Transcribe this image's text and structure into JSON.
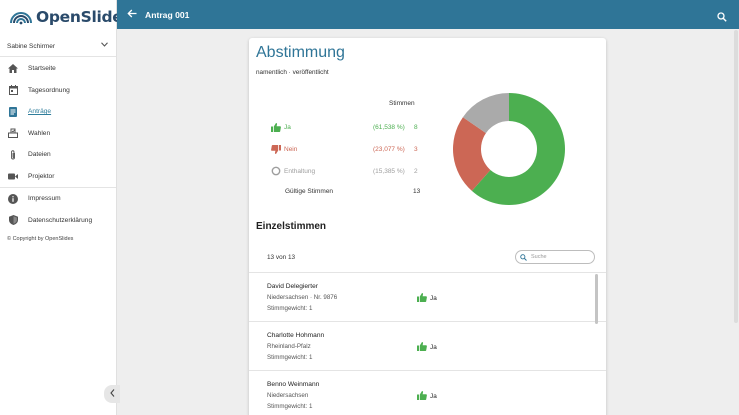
{
  "app": {
    "name": "OpenSlides"
  },
  "user": {
    "name": "Sabine Schirmer"
  },
  "nav": {
    "items": [
      {
        "label": "Startseite",
        "icon": "home-icon"
      },
      {
        "label": "Tagesordnung",
        "icon": "calendar-icon"
      },
      {
        "label": "Anträge",
        "icon": "document-icon",
        "active": true
      },
      {
        "label": "Wahlen",
        "icon": "ballot-icon"
      },
      {
        "label": "Dateien",
        "icon": "paperclip-icon"
      },
      {
        "label": "Projektor",
        "icon": "videocam-icon"
      }
    ],
    "secondary": [
      {
        "label": "Impressum",
        "icon": "info-icon"
      },
      {
        "label": "Datenschutzerklärung",
        "icon": "shield-icon"
      }
    ]
  },
  "copyright": "© Copyright by OpenSlides",
  "header": {
    "title": "Antrag 001"
  },
  "poll": {
    "title": "Abstimmung",
    "subtitle": "namentlich · veröffentlicht",
    "column_header": "Stimmen",
    "results": [
      {
        "label": "Ja",
        "percent": "(61,538 %)",
        "votes": "8",
        "color": "#4caf50",
        "icon": "thumb-up-icon"
      },
      {
        "label": "Nein",
        "percent": "(23,077 %)",
        "votes": "3",
        "color": "#cc6755",
        "icon": "thumb-down-icon"
      },
      {
        "label": "Enthaltung",
        "percent": "(15,385 %)",
        "votes": "2",
        "color": "#9e9e9e",
        "icon": "circle-icon"
      }
    ],
    "valid_label": "Gültige Stimmen",
    "valid_votes": "13"
  },
  "chart_data": {
    "type": "pie",
    "categories": [
      "Ja",
      "Nein",
      "Enthaltung"
    ],
    "values": [
      8,
      3,
      2
    ],
    "colors": [
      "#4caf50",
      "#cc6755",
      "#aaaaaa"
    ]
  },
  "single_votes": {
    "title": "Einzelstimmen",
    "count": "13 von 13",
    "search_placeholder": "Suche",
    "rows": [
      {
        "name": "David Delegierter",
        "region": "Niedersachsen · Nr. 9876",
        "weight": "Stimmgewicht: 1",
        "vote": "Ja"
      },
      {
        "name": "Charlotte Hohmann",
        "region": "Rheinland-Pfalz",
        "weight": "Stimmgewicht: 1",
        "vote": "Ja"
      },
      {
        "name": "Benno Weinmann",
        "region": "Niedersachsen",
        "weight": "Stimmgewicht: 1",
        "vote": "Ja"
      }
    ]
  }
}
